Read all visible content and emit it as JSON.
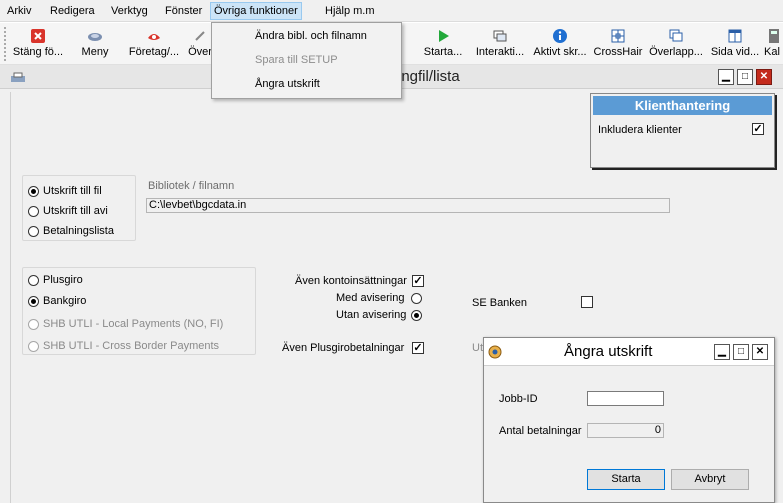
{
  "menubar": {
    "items": [
      "Arkiv",
      "Redigera",
      "Verktyg",
      "Fönster",
      "Övriga funktioner",
      "Hjälp m.m"
    ]
  },
  "toolbar": {
    "items": [
      {
        "label": "Stäng fö...",
        "icon": "close-red-icon"
      },
      {
        "label": "Meny",
        "icon": "menu-icon"
      },
      {
        "label": "Företag/...",
        "icon": "company-icon"
      },
      {
        "label": "Över",
        "icon": "overview-icon"
      },
      {
        "label": "Starta...",
        "icon": "play-icon"
      },
      {
        "label": "Interakti...",
        "icon": "interactive-icon"
      },
      {
        "label": "Aktivt skr...",
        "icon": "info-icon"
      },
      {
        "label": "CrossHair",
        "icon": "crosshair-icon"
      },
      {
        "label": "Överlapp...",
        "icon": "overlap-icon"
      },
      {
        "label": "Sida vid...",
        "icon": "side-by-side-icon"
      },
      {
        "label": "Kal",
        "icon": "calculator-icon"
      }
    ]
  },
  "dropdown": {
    "items": [
      {
        "label": "Ändra bibl. och filnamn",
        "enabled": true
      },
      {
        "label": "Spara till SETUP",
        "enabled": false
      },
      {
        "label": "Ångra utskrift",
        "enabled": true
      }
    ]
  },
  "main_window": {
    "title": "ingfil/lista"
  },
  "output_group": {
    "options": [
      {
        "label": "Utskrift till fil",
        "selected": true
      },
      {
        "label": "Utskrift till avi",
        "selected": false
      },
      {
        "label": "Betalningslista",
        "selected": false
      }
    ],
    "library_label": "Bibliotek / filnamn",
    "library_value": "C:\\levbet\\bgcdata.in"
  },
  "payment_group": {
    "options": [
      {
        "label": "Plusgiro",
        "selected": false,
        "enabled": true
      },
      {
        "label": "Bankgiro",
        "selected": true,
        "enabled": true
      },
      {
        "label": "SHB UTLI - Local Payments (NO, FI)",
        "selected": false,
        "enabled": false
      },
      {
        "label": "SHB UTLI - Cross Border Payments",
        "selected": false,
        "enabled": false
      }
    ]
  },
  "options": {
    "konto_label": "Även kontoinsättningar",
    "konto_checked": true,
    "med_avisering_label": "Med avisering",
    "utan_avisering_label": "Utan avisering",
    "plusgiro_label": "Även Plusgirobetalningar",
    "plusgiro_checked": true,
    "se_banken_label": "SE Banken",
    "se_banken_checked": false,
    "hidden_label": "Ut"
  },
  "klient": {
    "title": "Klienthantering",
    "include_label": "Inkludera klienter",
    "include_checked": true
  },
  "dialog": {
    "title": "Ångra utskrift",
    "jobb_label": "Jobb-ID",
    "jobb_value": "",
    "antal_label": "Antal betalningar",
    "antal_value": "0",
    "start_label": "Starta",
    "cancel_label": "Avbryt"
  },
  "colors": {
    "accent": "#5b9bd5",
    "menu_highlight": "#cce4f7",
    "close_red": "#c42b1c"
  }
}
